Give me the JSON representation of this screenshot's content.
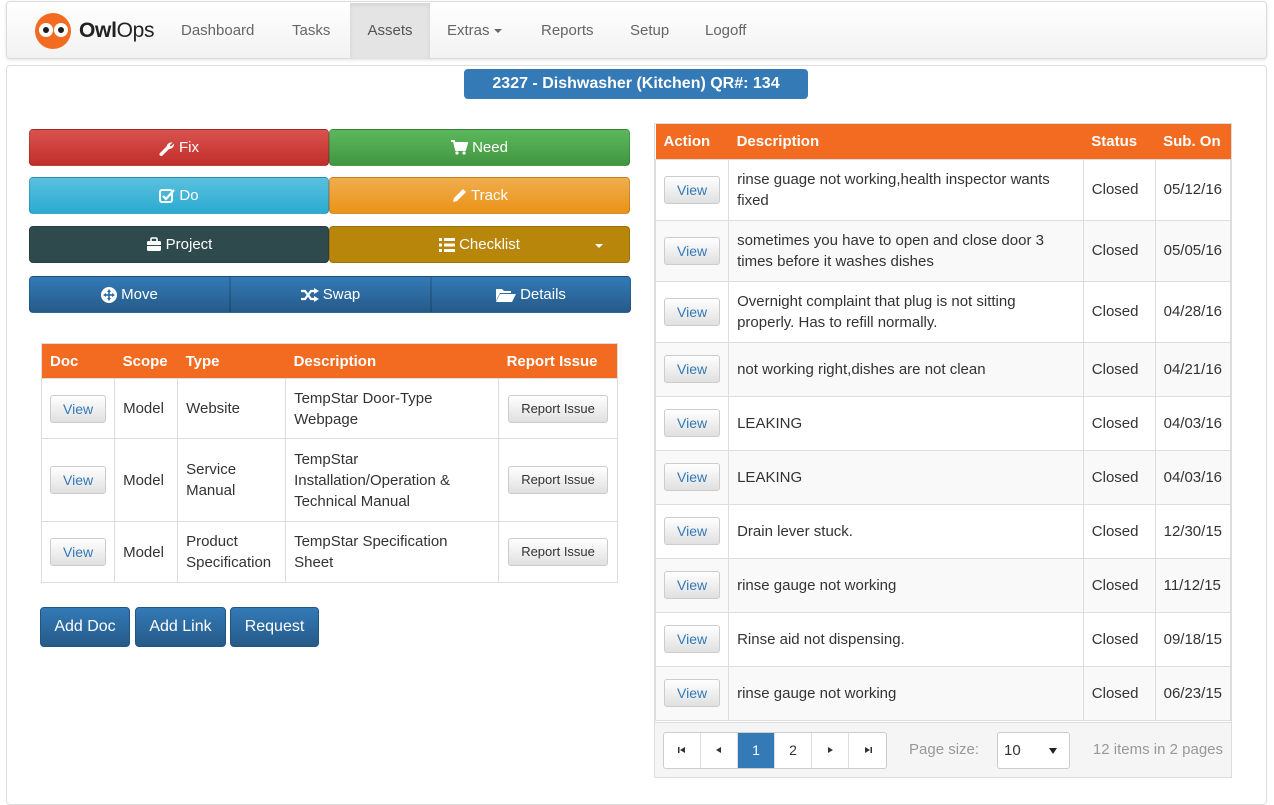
{
  "brand": {
    "name_bold": "Owl",
    "name_light": "Ops"
  },
  "nav": {
    "items": [
      {
        "label": "Dashboard"
      },
      {
        "label": "Tasks"
      },
      {
        "label": "Assets"
      },
      {
        "label": "Extras"
      },
      {
        "label": "Reports"
      },
      {
        "label": "Setup"
      },
      {
        "label": "Logoff"
      }
    ],
    "active": "Assets"
  },
  "asset": {
    "title": "2327 - Dishwasher (Kitchen) QR#: 134"
  },
  "actions": {
    "fix": "Fix",
    "need": "Need",
    "do": "Do",
    "track": "Track",
    "project": "Project",
    "checklist": "Checklist",
    "move": "Move",
    "swap": "Swap",
    "details": "Details"
  },
  "docs": {
    "headers": [
      "Doc",
      "Scope",
      "Type",
      "Description",
      "Report Issue"
    ],
    "rows": [
      {
        "doc": "View",
        "scope": "Model",
        "type": "Website",
        "description": "TempStar Door-Type Webpage",
        "report": "Report Issue"
      },
      {
        "doc": "View",
        "scope": "Model",
        "type": "Service Manual",
        "description": "TempStar Installation/Operation & Technical Manual",
        "report": "Report Issue"
      },
      {
        "doc": "View",
        "scope": "Model",
        "type": "Product Specification",
        "description": "TempStar Specification Sheet",
        "report": "Report Issue"
      }
    ],
    "buttons": {
      "add_doc": "Add Doc",
      "add_link": "Add Link",
      "request": "Request"
    }
  },
  "history": {
    "headers": [
      "Action",
      "Description",
      "Status",
      "Sub. On"
    ],
    "rows": [
      {
        "action": "View",
        "description": "rinse guage not working,health inspector wants fixed",
        "status": "Closed",
        "date": "05/12/16"
      },
      {
        "action": "View",
        "description": "sometimes you have to open and close door 3 times before it washes dishes",
        "status": "Closed",
        "date": "05/05/16"
      },
      {
        "action": "View",
        "description": "Overnight complaint that plug is not sitting properly. Has to refill normally.",
        "status": "Closed",
        "date": "04/28/16"
      },
      {
        "action": "View",
        "description": "not working right,dishes are not clean",
        "status": "Closed",
        "date": "04/21/16"
      },
      {
        "action": "View",
        "description": "LEAKING",
        "status": "Closed",
        "date": "04/03/16"
      },
      {
        "action": "View",
        "description": "LEAKING",
        "status": "Closed",
        "date": "04/03/16"
      },
      {
        "action": "View",
        "description": "Drain lever stuck.",
        "status": "Closed",
        "date": "12/30/15"
      },
      {
        "action": "View",
        "description": "rinse gauge not working",
        "status": "Closed",
        "date": "11/12/15"
      },
      {
        "action": "View",
        "description": "Rinse aid not dispensing.",
        "status": "Closed",
        "date": "09/18/15"
      },
      {
        "action": "View",
        "description": "rinse gauge not working",
        "status": "Closed",
        "date": "06/23/15"
      }
    ],
    "pager": {
      "pages": [
        "1",
        "2"
      ],
      "current_page": "1",
      "page_size_label": "Page size:",
      "page_size": "10",
      "info": "12 items in 2 pages"
    }
  }
}
